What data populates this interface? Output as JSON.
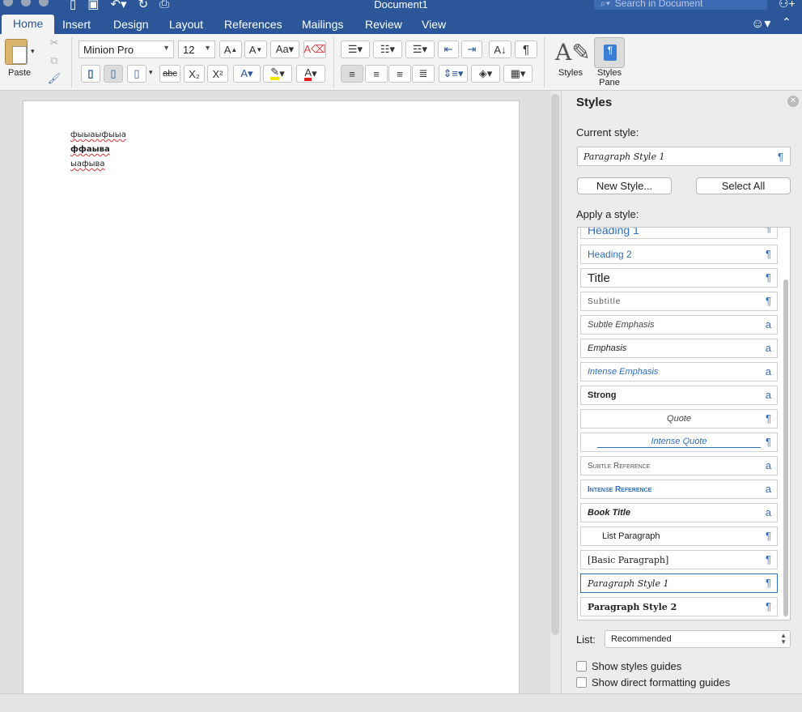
{
  "window": {
    "title": "Document1",
    "search_placeholder": "Search in Document"
  },
  "tabs": [
    {
      "label": "Home",
      "active": true
    },
    {
      "label": "Insert"
    },
    {
      "label": "Design"
    },
    {
      "label": "Layout"
    },
    {
      "label": "References"
    },
    {
      "label": "Mailings"
    },
    {
      "label": "Review"
    },
    {
      "label": "View"
    }
  ],
  "ribbon": {
    "paste_label": "Paste",
    "font_name": "Minion Pro",
    "font_size": "12",
    "strike_label": "abc",
    "subscript_label": "X₂",
    "superscript_label": "X²",
    "pilcrow": "¶",
    "styles_label": "Styles",
    "styles_pane_label": "Styles Pane",
    "highlight_color": "#f5e400",
    "font_color": "#e0201b"
  },
  "document": {
    "paragraphs": [
      "фыыаыфыыа",
      "ффаыва",
      "ыафыва"
    ]
  },
  "styles_pane": {
    "title": "Styles",
    "current_style_label": "Current style:",
    "current_style": "Paragraph Style 1",
    "new_style_button": "New Style...",
    "select_all_button": "Select All",
    "apply_label": "Apply a style:",
    "styles": [
      {
        "name": "Heading 1",
        "mark": "¶"
      },
      {
        "name": "Heading 2",
        "mark": "¶"
      },
      {
        "name": "Title",
        "mark": "¶"
      },
      {
        "name": "Subtitle",
        "mark": "¶"
      },
      {
        "name": "Subtle Emphasis",
        "mark": "a"
      },
      {
        "name": "Emphasis",
        "mark": "a"
      },
      {
        "name": "Intense Emphasis",
        "mark": "a"
      },
      {
        "name": "Strong",
        "mark": "a"
      },
      {
        "name": "Quote",
        "mark": "¶"
      },
      {
        "name": "Intense Quote",
        "mark": "¶"
      },
      {
        "name": "Subtle Reference",
        "mark": "a"
      },
      {
        "name": "Intense Reference",
        "mark": "a"
      },
      {
        "name": "Book Title",
        "mark": "a"
      },
      {
        "name": "List Paragraph",
        "mark": "¶"
      },
      {
        "name": "[Basic Paragraph]",
        "mark": "¶"
      },
      {
        "name": "Paragraph Style 1",
        "mark": "¶",
        "selected": true
      },
      {
        "name": "Paragraph Style 2",
        "mark": "¶"
      }
    ],
    "list_label": "List:",
    "list_value": "Recommended",
    "show_styles_guides": "Show styles guides",
    "show_direct_formatting": "Show direct formatting guides"
  },
  "colors": {
    "accent": "#2b579a",
    "style_blue": "#2f6fbf"
  }
}
